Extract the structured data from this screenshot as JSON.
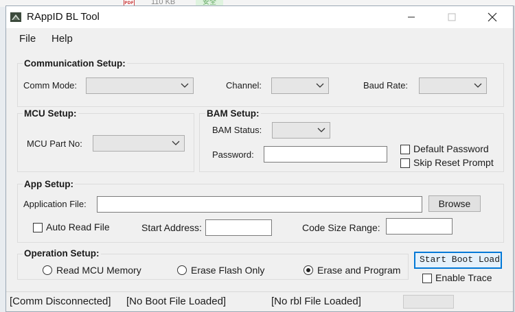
{
  "background": {
    "size": "110 KB",
    "safe": "安全"
  },
  "window": {
    "title": "RAppID BL Tool"
  },
  "menu": {
    "file": "File",
    "help": "Help"
  },
  "comm": {
    "title": "Communication Setup:",
    "comm_mode": "Comm Mode:",
    "channel": "Channel:",
    "baud_rate": "Baud Rate:"
  },
  "mcu": {
    "title": "MCU Setup:",
    "part_no": "MCU Part No:"
  },
  "bam": {
    "title": "BAM Setup:",
    "status": "BAM Status:",
    "password": "Password:",
    "default_password": "Default Password",
    "skip_reset": "Skip Reset Prompt"
  },
  "app": {
    "title": "App Setup:",
    "application_file": "Application File:",
    "browse": "Browse",
    "auto_read": "Auto Read File",
    "start_address": "Start Address:",
    "code_size": "Code Size Range:"
  },
  "operation": {
    "title": "Operation Setup:",
    "read": "Read MCU Memory",
    "erase": "Erase Flash Only",
    "erase_program": "Erase and Program",
    "selected": "Erase and Program"
  },
  "actions": {
    "start_boot": "Start Boot Loader",
    "enable_trace": "Enable Trace"
  },
  "status": {
    "comm": "[Comm Disconnected]",
    "boot": "[No Boot File Loaded]",
    "rbl": "[No rbl File Loaded]"
  },
  "colors": {
    "focus_border": "#0078d7",
    "window_bg": "#f0f0f0"
  }
}
